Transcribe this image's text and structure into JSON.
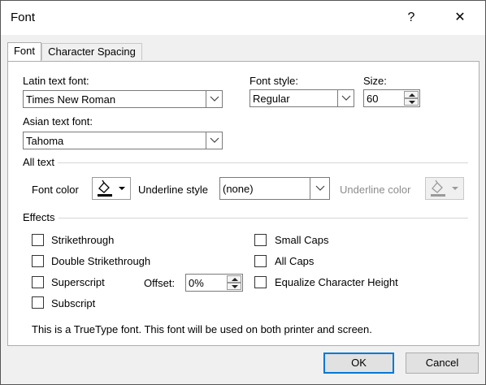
{
  "window": {
    "title": "Font",
    "help": "?",
    "close": "✕"
  },
  "tabs": [
    {
      "label": "Font",
      "accel": "n",
      "active": true
    },
    {
      "label": "Character Spacing",
      "active": false
    }
  ],
  "latin": {
    "label": "Latin text font:",
    "value": "Times New Roman"
  },
  "font_style": {
    "label": "Font style:",
    "value": "Regular"
  },
  "size": {
    "label": "Size:",
    "value": "60"
  },
  "asian": {
    "label": "Asian text font:",
    "value": "Tahoma"
  },
  "all_text": {
    "group": "All text",
    "font_color_label": "Font color",
    "underline_style_label": "Underline style",
    "underline_style_value": "(none)",
    "underline_color_label": "Underline color"
  },
  "effects": {
    "group": "Effects",
    "strikethrough": {
      "label": "Strikethrough",
      "checked": false
    },
    "double_strikethrough": {
      "label": "Double Strikethrough",
      "checked": false
    },
    "superscript": {
      "label": "Superscript",
      "checked": false
    },
    "subscript": {
      "label": "Subscript",
      "checked": false
    },
    "offset_label": "Offset:",
    "offset_value": "0%",
    "small_caps": {
      "label": "Small Caps",
      "checked": false
    },
    "all_caps": {
      "label": "All Caps",
      "checked": false
    },
    "equalize": {
      "label": "Equalize Character Height",
      "checked": false
    }
  },
  "info_text": "This is a TrueType font. This font will be used on both printer and screen.",
  "buttons": {
    "ok": "OK",
    "cancel": "Cancel"
  },
  "colors": {
    "accent": "#0078d7",
    "font_color_bar": "#000000",
    "underline_color_bar": "#9a9a9a"
  }
}
